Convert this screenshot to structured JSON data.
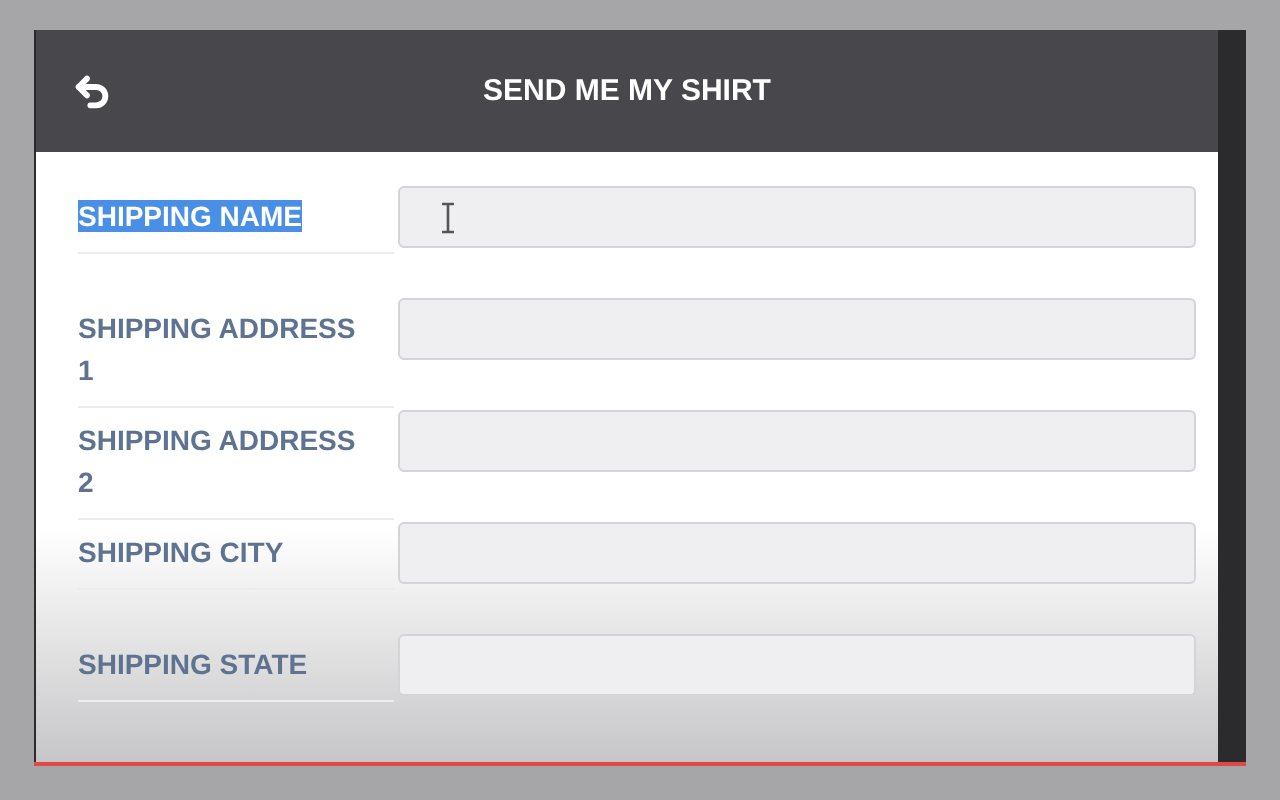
{
  "header": {
    "title": "SEND ME MY SHIRT"
  },
  "fields": [
    {
      "label": "SHIPPING NAME",
      "selected": true,
      "cursor": true
    },
    {
      "label": "SHIPPING ADDRESS 1",
      "selected": false,
      "cursor": false
    },
    {
      "label": "SHIPPING ADDRESS 2",
      "selected": false,
      "cursor": false
    },
    {
      "label": "SHIPPING CITY",
      "selected": false,
      "cursor": false
    },
    {
      "label": "SHIPPING STATE",
      "selected": false,
      "cursor": false
    }
  ]
}
